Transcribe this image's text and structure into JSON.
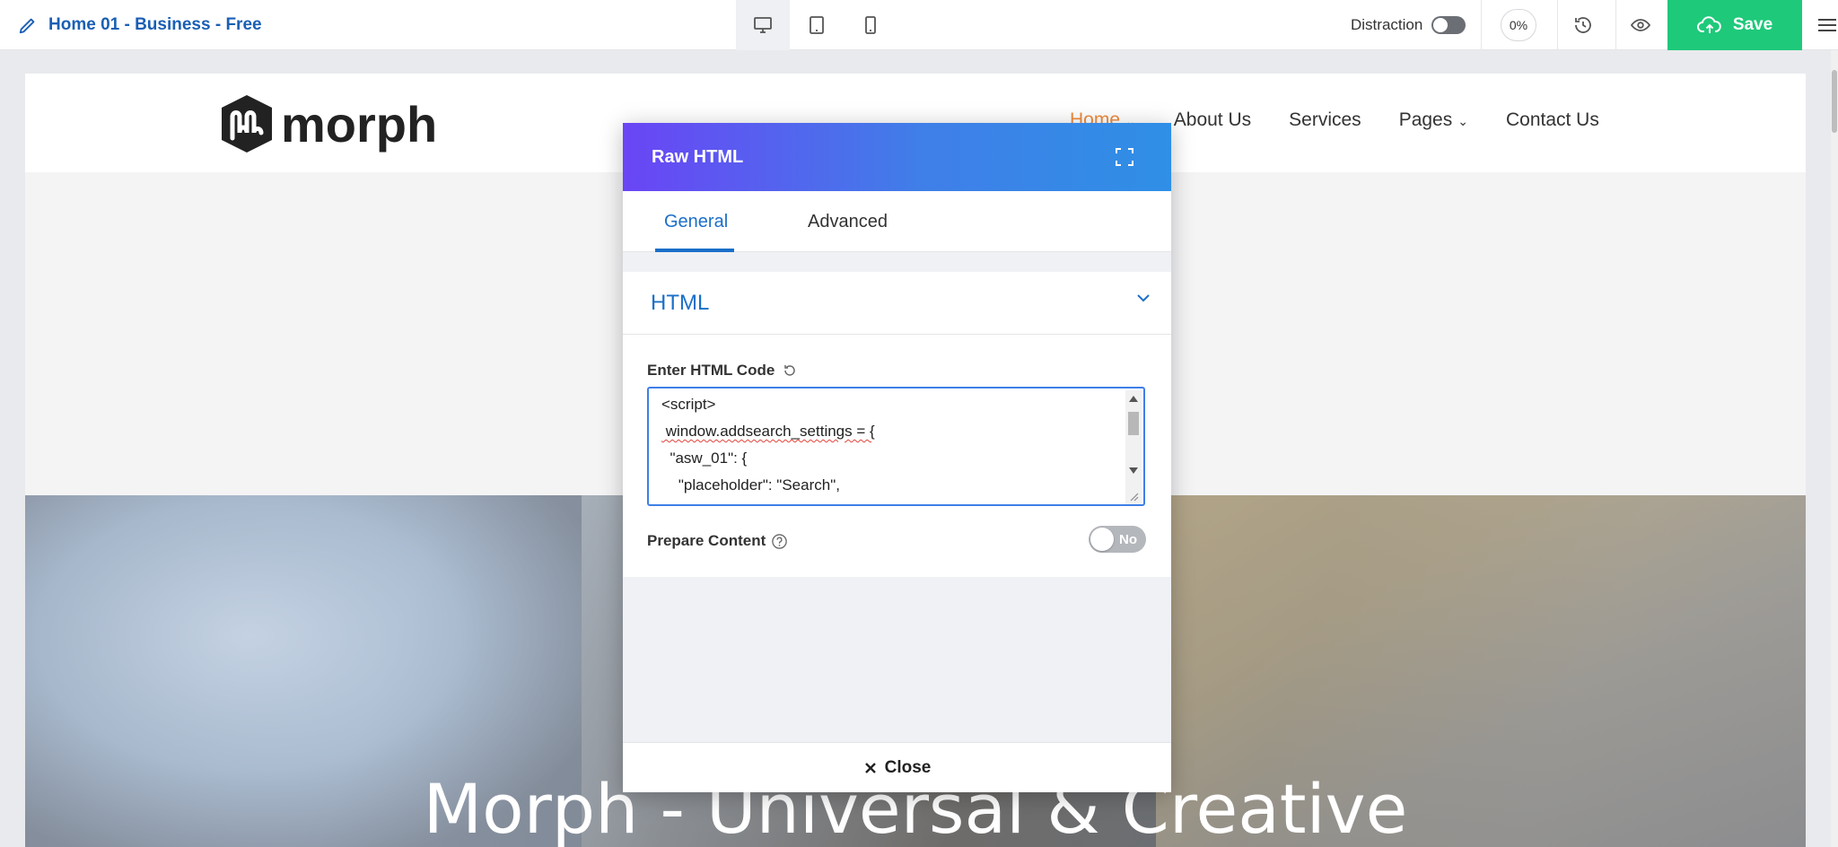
{
  "toolbar": {
    "page_title": "Home 01 - Business - Free",
    "devices": [
      "desktop",
      "tablet",
      "mobile"
    ],
    "distraction_label": "Distraction",
    "progress_label": "0%",
    "save_label": "Save",
    "colors": {
      "title": "#1a5fb4",
      "save_bg": "#1ec97a"
    }
  },
  "site": {
    "logo_text": "morph",
    "nav": [
      {
        "label": "Home",
        "has_dropdown": true
      },
      {
        "label": "About Us",
        "has_dropdown": false
      },
      {
        "label": "Services",
        "has_dropdown": false
      },
      {
        "label": "Pages",
        "has_dropdown": true
      },
      {
        "label": "Contact Us",
        "has_dropdown": false
      }
    ],
    "hero_title": "Morph - Universal & Creative",
    "colors": {
      "nav_active": "#f08a3c"
    }
  },
  "modal": {
    "title": "Raw HTML",
    "tabs": [
      "General",
      "Advanced"
    ],
    "active_tab": "General",
    "section_title": "HTML",
    "field_label": "Enter HTML Code",
    "code_lines": [
      "<script>",
      " window.addsearch_settings = {",
      "  \"asw_01\": {",
      "    \"placeholder\": \"Search\","
    ],
    "prepare_label": "Prepare Content",
    "prepare_value": "No",
    "close_label": "Close",
    "colors": {
      "header_start": "#6a45f5",
      "header_end": "#2f8fe6",
      "accent": "#1a6fc9"
    }
  }
}
